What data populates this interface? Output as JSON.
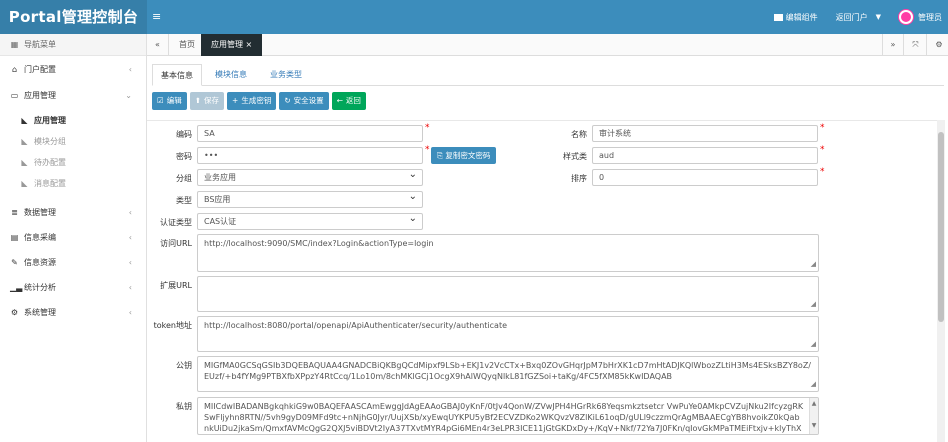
{
  "header": {
    "logo": "Portal管理控制台",
    "menu_toggle": "≡",
    "edit_component": "编辑组件",
    "portal_link": "返回门户",
    "user": "管理员",
    "colors": {
      "primary": "#3c8dbc",
      "logo_bg": "#367fa9"
    }
  },
  "sidebar": {
    "nav_title": "导航菜单",
    "items": [
      {
        "label": "门户配置",
        "icon": "bank-icon",
        "arrow": "‹"
      },
      {
        "label": "应用管理",
        "icon": "monitor-icon",
        "arrow": "⌄"
      },
      {
        "label": "数据管理",
        "icon": "list-icon",
        "arrow": "‹"
      },
      {
        "label": "信息采编",
        "icon": "newspaper-icon",
        "arrow": "‹"
      },
      {
        "label": "信息资源",
        "icon": "edit-icon",
        "arrow": "‹"
      },
      {
        "label": "统计分析",
        "icon": "chart-icon",
        "arrow": "‹"
      },
      {
        "label": "系统管理",
        "icon": "cogs-icon",
        "arrow": "‹"
      }
    ],
    "subitems": [
      "应用管理",
      "模块分组",
      "待办配置",
      "消息配置"
    ]
  },
  "page_tabs": {
    "home": "首页",
    "active": "应用管理",
    "close": "×"
  },
  "inner_tabs": [
    "基本信息",
    "模块信息",
    "业务类型"
  ],
  "toolbar": {
    "edit": "编辑",
    "save": "保存",
    "gen_key": "生成密钥",
    "security": "安全设置",
    "back": "返回"
  },
  "form": {
    "code_label": "编码",
    "code_value": "SA",
    "name_label": "名称",
    "name_value": "审计系统",
    "password_label": "密码",
    "password_value": "•••",
    "copy_btn": "复制密文密码",
    "style_label": "样式类",
    "style_value": "aud",
    "group_label": "分组",
    "group_value": "业务应用",
    "sort_label": "排序",
    "sort_value": "0",
    "type_label": "类型",
    "type_value": "BS应用",
    "auth_label": "认证类型",
    "auth_value": "CAS认证",
    "url_label": "访问URL",
    "url_value": "http://localhost:9090/SMC/index?Login&actionType=login",
    "ext_label": "扩展URL",
    "ext_value": "",
    "token_label": "token地址",
    "token_value": "http://localhost:8080/portal/openapi/ApiAuthenticater/security/authenticate",
    "pubkey_label": "公钥",
    "pubkey_value": "MIGfMA0GCSqGSIb3DQEBAQUAA4GNADCBiQKBgQCdMipxf9LSb+EKJ1v2VcCTx+Bxq0ZOvGHqrJpM7bHrXK1cD7mHtADJKQlWbozZLtiH3Ms4ESksBZY8oZ/EUzf/+b4fYMg9PTBXfbXPpzY4RtCcq/1Lo10m/8chMKlGCj1OcgX9hAlWQyqNlkL81fGZSoi+taKg/4FC5fXM85kKwIDAQAB",
    "privkey_label": "私钥",
    "privkey_value": "MIICdwIBADANBgkqhkiG9w0BAQEFAASCAmEwggJdAgEAAoGBAJ0yKnF/0tJv4QonW/ZVwJPH4HGrRk68Yeqsmkztsetcr VwPuYe0AMkpCVZujNku2IfcyzgRKSwFljyhn8RTN//5vh9gyD09MFd9tc+nNjhG0Jyr/UujXSb/xyEwqUYKPU5yBf2ECVZDKo2WKQvzV8ZlKiL61oqD/gULl9czzmQrAgMBAAECgYB8hvoikZ0kQabnkUiDu2jkaSm/QmxfAVMcQgG2QXJ5viBDVt2IyA37TXvtMYR4pGi6MEn4r3eLPR3ICE11jGtGKDxDy+/KqV+Nkf/72Ya7J0FKn/qIovGkMPaTMEiFtxjv+klyThXK0lkXcNw0Yt7+zjSE3"
  }
}
